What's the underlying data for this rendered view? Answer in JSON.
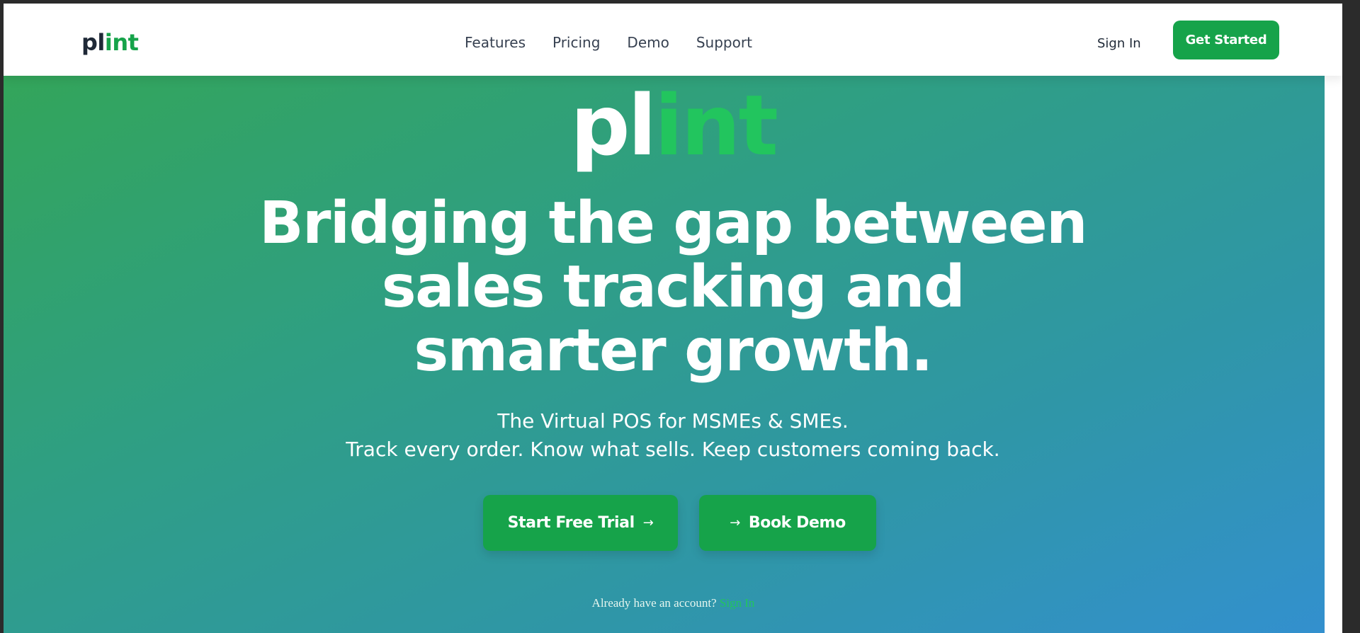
{
  "nav": {
    "logo_pl": "pl",
    "logo_int": "int",
    "links": [
      "Features",
      "Pricing",
      "Demo",
      "Support"
    ],
    "sign_in": "Sign In",
    "get_started": "Get Started"
  },
  "hero": {
    "logo_pl": "pl",
    "logo_int": "int",
    "headline": "Bridging the gap between sales tracking and smarter growth.",
    "sub_line1": "The Virtual POS for MSMEs & SMEs.",
    "sub_line2": "Track every order. Know what sells. Keep customers coming back.",
    "cta_trial": "Start Free Trial",
    "cta_demo": "Book Demo",
    "arrow_glyph": "→",
    "already_text": "Already have an account?",
    "already_link": "Sign In"
  },
  "colors": {
    "brand_green": "#16a34a",
    "accent_green": "#22c55e",
    "text_dark": "#1f2937",
    "gradient_start": "#33a55a",
    "gradient_end": "#3390cf"
  }
}
